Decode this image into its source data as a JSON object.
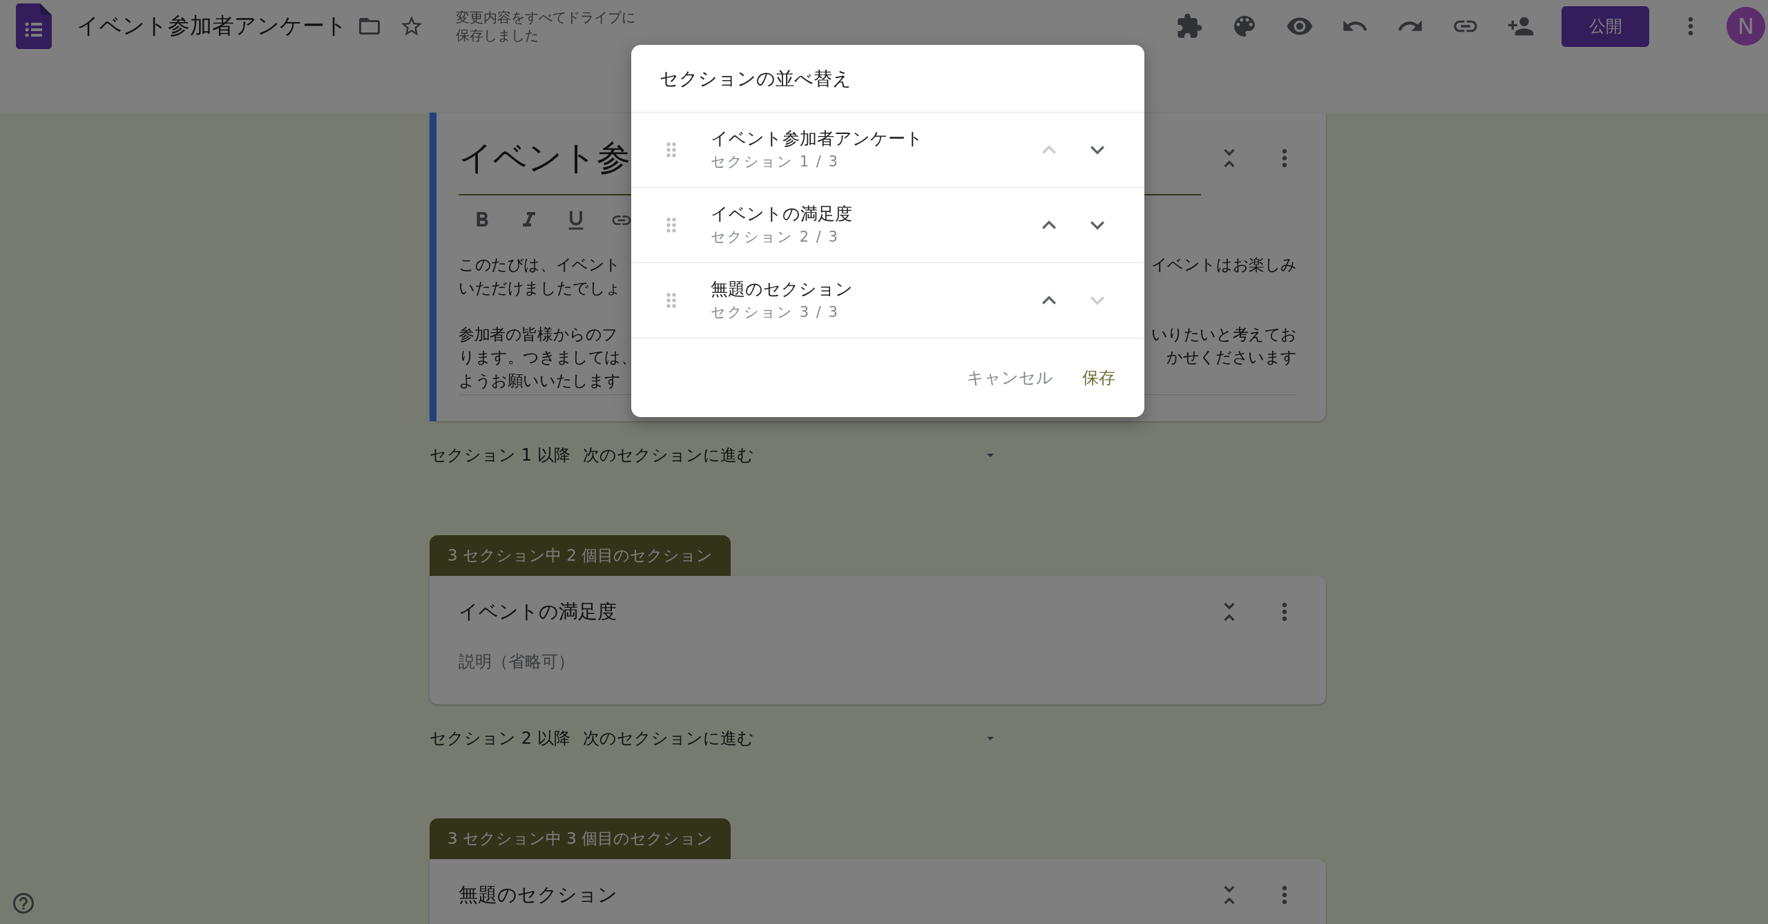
{
  "header": {
    "title": "イベント参加者アンケート",
    "save_status": "変更内容をすべてドライブに保存しました",
    "publish_button": "公開",
    "avatar": "N"
  },
  "form": {
    "intro": {
      "title": "イベント参",
      "paragraphs": [
        {
          "lines": [
            {
              "left": "このたびは、イベント",
              "right": "イベントはお楽しみ"
            },
            {
              "left": "いただけましたでしょ"
            }
          ]
        },
        {
          "lines": [
            {
              "left": "参加者の皆様からのフ",
              "right": "いりたいと考えてお"
            },
            {
              "left": "ります。つきましては、",
              "right": "かせくださいます"
            },
            {
              "left": "ようお願いいたします"
            }
          ]
        }
      ],
      "after": {
        "label": "セクション 1 以降",
        "action": "次のセクションに進む"
      }
    },
    "sections": [
      {
        "badge": "3 セクション中 2 個目のセクション",
        "title": "イベントの満足度",
        "placeholder": "説明（省略可）",
        "after": {
          "label": "セクション 2 以降",
          "action": "次のセクションに進む"
        }
      },
      {
        "badge": "3 セクション中 3 個目のセクション",
        "title": "無題のセクション"
      }
    ]
  },
  "dialog": {
    "title": "セクションの並べ替え",
    "items": [
      {
        "title": "イベント参加者アンケート",
        "subtitle": "セクション 1 / 3",
        "up_disabled": true,
        "down_disabled": false
      },
      {
        "title": "イベントの満足度",
        "subtitle": "セクション 2 / 3",
        "up_disabled": false,
        "down_disabled": false
      },
      {
        "title": "無題のセクション",
        "subtitle": "セクション 3 / 3",
        "up_disabled": false,
        "down_disabled": true
      }
    ],
    "cancel": "キャンセル",
    "save": "保存"
  }
}
